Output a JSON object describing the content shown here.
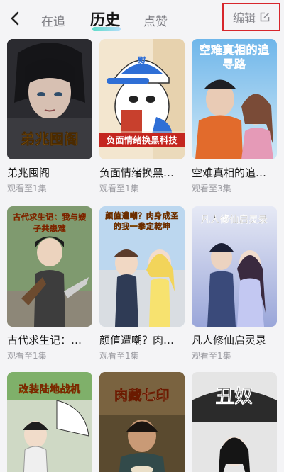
{
  "header": {
    "tabs": [
      {
        "label": "在追",
        "active": false
      },
      {
        "label": "历史",
        "active": true
      },
      {
        "label": "点赞",
        "active": false
      }
    ],
    "edit_label": "编辑",
    "accent_color": "#d7262c"
  },
  "cards": [
    {
      "title": "弟兆囤阁",
      "progress": "观看至1集",
      "poster_text": "弟兆囤阁"
    },
    {
      "title": "负面情绪换黑…",
      "progress": "观看至1集",
      "poster_text": "负面情绪换黑科技",
      "cap_text": "熨"
    },
    {
      "title": "空难真相的追…",
      "progress": "观看至3集",
      "poster_text": "空难真相的追寻路"
    },
    {
      "title": "古代求生记：…",
      "progress": "观看至1集",
      "poster_text": "古代求生记：我与嫂子共患难"
    },
    {
      "title": "颜值遭嘲？肉…",
      "progress": "观看至1集",
      "poster_text": "颜值遭嘲？肉身成圣的我一拳定乾坤"
    },
    {
      "title": "凡人修仙启灵录",
      "progress": "观看至1集",
      "poster_text": "凡人修仙启灵录"
    },
    {
      "title": "",
      "progress": "",
      "poster_text": "改装陆地战机"
    },
    {
      "title": "",
      "progress": "",
      "poster_text": "肉藏七印"
    },
    {
      "title": "",
      "progress": "",
      "poster_text": "丑奴"
    }
  ]
}
